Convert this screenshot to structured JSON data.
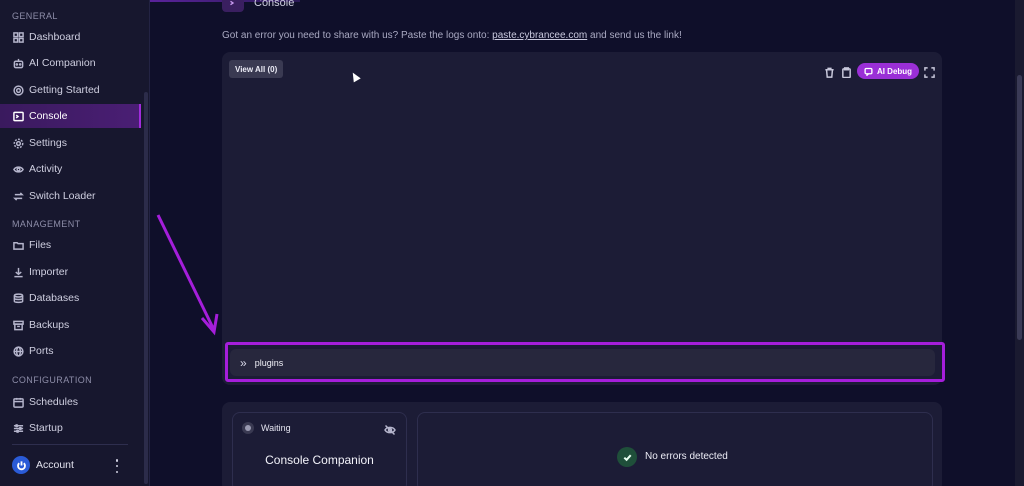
{
  "sidebar": {
    "general_title": "GENERAL",
    "general_items": [
      {
        "label": "Dashboard",
        "icon": "dashboard-icon"
      },
      {
        "label": "AI Companion",
        "icon": "robot-icon"
      },
      {
        "label": "Getting Started",
        "icon": "lifebuoy-icon"
      },
      {
        "label": "Console",
        "icon": "terminal-icon",
        "active": true
      },
      {
        "label": "Settings",
        "icon": "gear-icon"
      },
      {
        "label": "Activity",
        "icon": "eye-icon"
      },
      {
        "label": "Switch Loader",
        "icon": "swap-icon"
      }
    ],
    "management_title": "MANAGEMENT",
    "management_items": [
      {
        "label": "Files",
        "icon": "folder-icon"
      },
      {
        "label": "Importer",
        "icon": "download-icon"
      },
      {
        "label": "Databases",
        "icon": "database-icon"
      },
      {
        "label": "Backups",
        "icon": "archive-icon"
      },
      {
        "label": "Ports",
        "icon": "globe-icon"
      }
    ],
    "configuration_title": "CONFIGURATION",
    "configuration_items": [
      {
        "label": "Schedules",
        "icon": "calendar-icon"
      },
      {
        "label": "Startup",
        "icon": "sliders-icon"
      }
    ],
    "account_label": "Account"
  },
  "main": {
    "page_title": "Console",
    "notice_prefix": "Got an error you need to share with us? Paste the logs onto: ",
    "notice_link": "paste.cybrancee.com",
    "notice_suffix": " and send us the link!",
    "view_all_label": "View All (0)",
    "ai_debug_label": "AI Debug",
    "command_value": "plugins",
    "companion": {
      "status": "Waiting",
      "title": "Console Companion"
    },
    "errors_text": "No errors detected"
  },
  "colors": {
    "background": "#0f0f2a",
    "sidebar": "#17172e",
    "accent": "#9a2fd6",
    "highlight": "#a51edb",
    "success": "#1f4f3a"
  }
}
